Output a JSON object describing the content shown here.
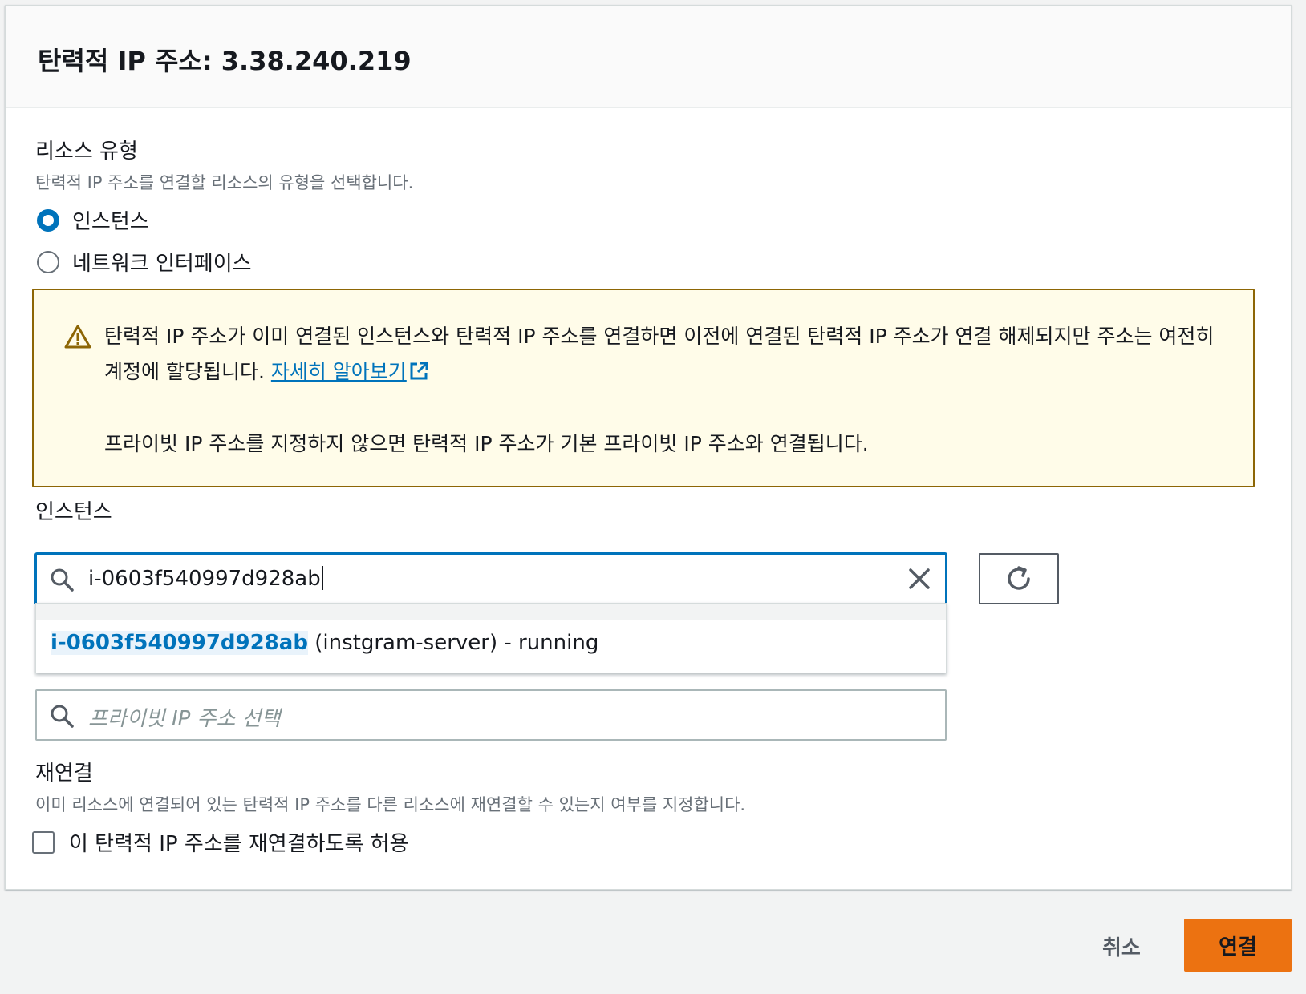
{
  "dialog": {
    "title": "탄력적 IP 주소: 3.38.240.219"
  },
  "resource_type": {
    "label": "리소스 유형",
    "description": "탄력적 IP 주소를 연결할 리소스의 유형을 선택합니다.",
    "options": [
      {
        "label": "인스턴스",
        "checked": true
      },
      {
        "label": "네트워크 인터페이스",
        "checked": false
      }
    ]
  },
  "alert": {
    "text_main": "탄력적 IP 주소가 이미 연결된 인스턴스와 탄력적 IP 주소를 연결하면 이전에 연결된 탄력적 IP 주소가 연결 해제되지만 주소는 여전히 계정에 할당됩니다. ",
    "link": "자세히 알아보기",
    "text_second": "프라이빗 IP 주소를 지정하지 않으면 탄력적 IP 주소가 기본 프라이빗 IP 주소와 연결됩니다."
  },
  "instance": {
    "label": "인스턴스",
    "value": "i-0603f540997d928ab",
    "dropdown": {
      "match": "i-0603f540997d928ab",
      "rest": " (instgram-server) - running"
    }
  },
  "private_ip": {
    "placeholder": "프라이빗 IP 주소 선택"
  },
  "reassociation": {
    "label": "재연결",
    "description": "이미 리소스에 연결되어 있는 탄력적 IP 주소를 다른 리소스에 재연결할 수 있는지 여부를 지정합니다.",
    "checkbox_label": "이 탄력적 IP 주소를 재연결하도록 허용"
  },
  "footer": {
    "cancel": "취소",
    "associate": "연결"
  },
  "colors": {
    "primary": "#ec7211",
    "link": "#0073bb",
    "alert_bg": "#fffce9",
    "alert_border": "#8d6605"
  }
}
